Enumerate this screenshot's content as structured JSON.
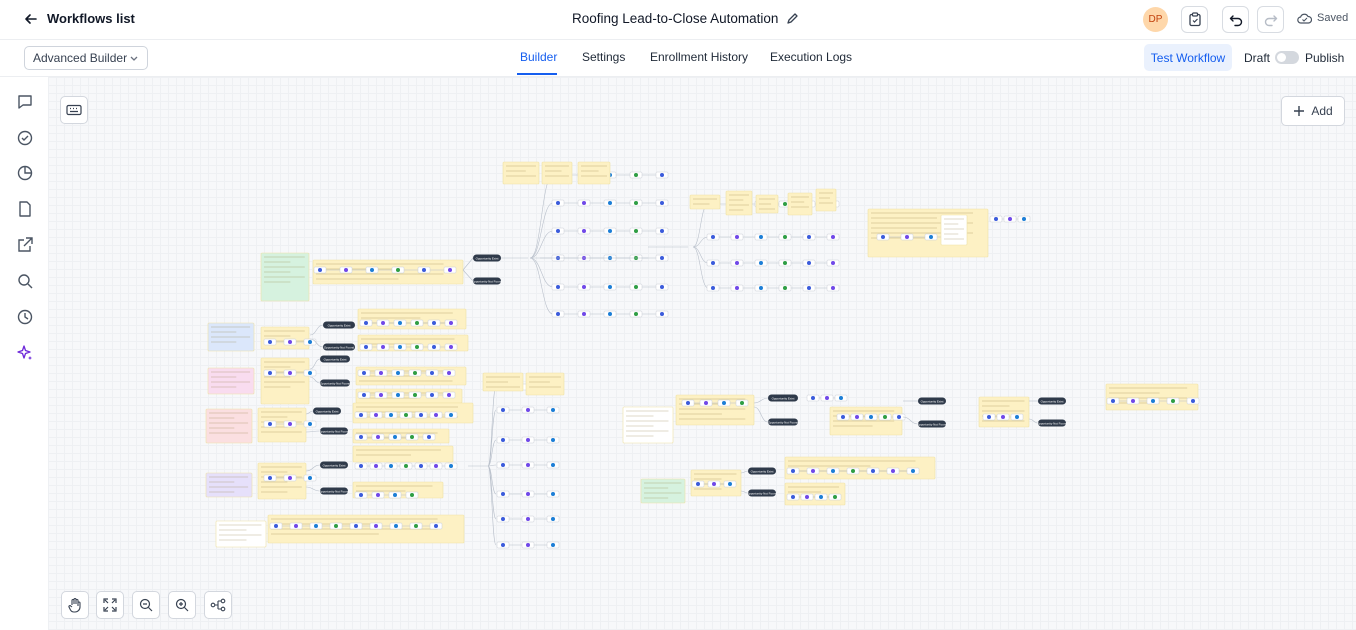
{
  "header": {
    "back_label": "Workflows list",
    "workflow_title": "Roofing Lead-to-Close Automation",
    "avatar_initials": "DP",
    "saved_label": "Saved"
  },
  "nav": {
    "builder_mode": "Advanced Builder",
    "tabs": [
      "Builder",
      "Settings",
      "Enrollment History",
      "Execution Logs"
    ],
    "active_tab": "Builder",
    "test_label": "Test Workflow",
    "draft_label": "Draft",
    "publish_label": "Publish"
  },
  "canvas": {
    "add_label": "Add",
    "pill_labels": [
      "Opportunity Exist",
      "Opportunity Not Found",
      "Opportunity Exist",
      "Opportunity Not Found",
      "Opportunity Exist",
      "Opportunity Not Found",
      "Opportunity Exist",
      "Opportunity Not Found",
      "Opportunity Exist",
      "Opportunity Not Found",
      "Opportunity Exist",
      "Opportunity Not Found"
    ]
  },
  "sidebar_icons": [
    "chat-icon",
    "check-circle-icon",
    "pie-chart-icon",
    "document-icon",
    "external-link-icon",
    "search-icon",
    "history-icon",
    "sparkle-icon"
  ],
  "canvas_controls": [
    "hand-icon",
    "fit-screen-icon",
    "zoom-out-icon",
    "zoom-in-icon",
    "layout-icon"
  ],
  "colors": {
    "accent": "#155eef",
    "note_yellow": "#fdf1c4",
    "note_green": "#d6f2df",
    "note_blue": "#dbe7fb",
    "note_pink": "#f9dcef",
    "note_red": "#fbdfe1",
    "note_purple": "#e6e0fb",
    "pill_dark": "#2f3a4a"
  }
}
